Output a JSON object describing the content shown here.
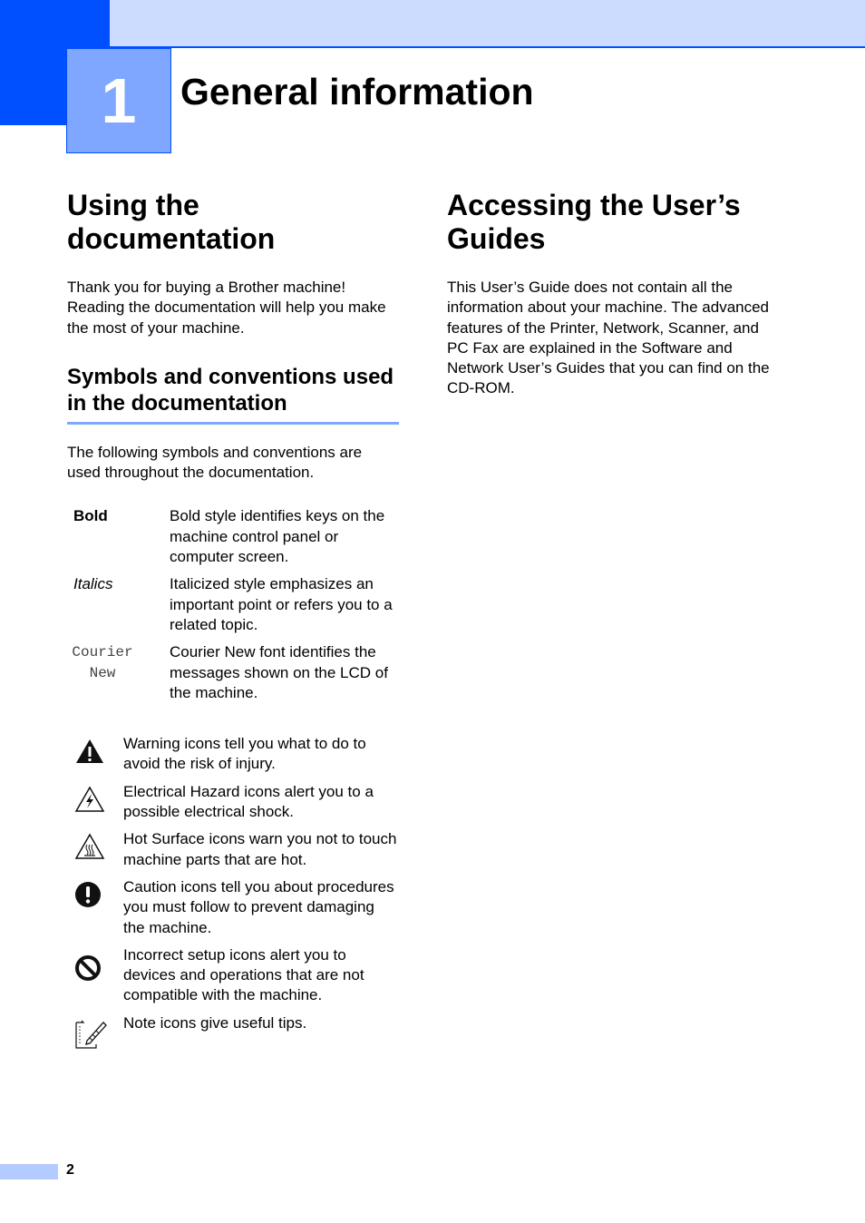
{
  "chapter": {
    "number": "1",
    "title": "General information"
  },
  "left": {
    "heading": "Using the documentation",
    "intro": "Thank you for buying a Brother machine! Reading the documentation will help you make the most of your machine.",
    "subheading": "Symbols and conventions used in the documentation",
    "follow": "The following symbols and conventions are used throughout the documentation.",
    "conventions": [
      {
        "term": "Bold",
        "style": "bold",
        "desc": "Bold style identifies keys on the machine control panel or computer screen."
      },
      {
        "term": "Italics",
        "style": "italic",
        "desc": "Italicized style emphasizes an important point or refers you to a related topic."
      },
      {
        "term": "Courier New",
        "style": "mono",
        "desc": "Courier New font identifies the messages shown on the LCD of the machine."
      }
    ],
    "icons": [
      {
        "icon": "warning-icon",
        "text": "Warning icons tell you what to do to avoid the risk of injury."
      },
      {
        "icon": "electrical-hazard-icon",
        "text": "Electrical Hazard icons alert you to a possible electrical shock."
      },
      {
        "icon": "hot-surface-icon",
        "text": "Hot Surface icons warn you not to touch machine parts that are hot."
      },
      {
        "icon": "caution-icon",
        "text": "Caution icons tell you about procedures you must follow to prevent damaging the machine."
      },
      {
        "icon": "incorrect-setup-icon",
        "text": "Incorrect setup icons alert you to devices and operations that are not compatible with the machine."
      },
      {
        "icon": "note-icon",
        "text": "Note icons give useful tips."
      }
    ]
  },
  "right": {
    "heading": "Accessing the User’s Guides",
    "body": "This User’s Guide does not contain all the information about your machine. The advanced features of the Printer, Network, Scanner, and PC Fax are explained in the Software and Network User’s Guides that you can find on the CD-ROM."
  },
  "footer": {
    "page_number": "2"
  },
  "colors": {
    "brand_dark": "#0050ff",
    "brand_mid": "#7fa7ff",
    "brand_light": "#ccdcff"
  }
}
